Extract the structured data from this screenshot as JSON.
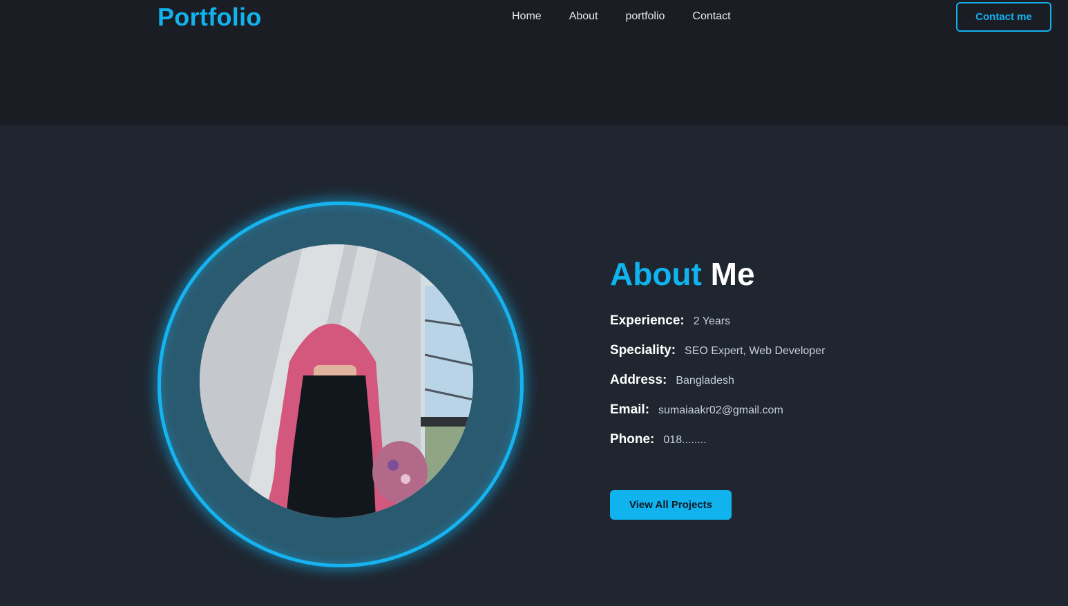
{
  "header": {
    "logo": "Portfolio",
    "nav": [
      "Home",
      "About",
      "portfolio",
      "Contact"
    ],
    "contact_button": "Contact me"
  },
  "about": {
    "title_accent": "About",
    "title_rest": "Me",
    "rows": [
      {
        "label": "Experience:",
        "value": "2 Years"
      },
      {
        "label": "Speciality:",
        "value": "SEO Expert, Web Developer"
      },
      {
        "label": "Address:",
        "value": "Bangladesh"
      },
      {
        "label": "Email:",
        "value": "sumaiaakr02@gmail.com"
      },
      {
        "label": "Phone:",
        "value": "018........"
      }
    ],
    "projects_button": "View All Projects"
  },
  "colors": {
    "accent": "#11b3ef",
    "header_bg": "#1a1d23",
    "page_bg": "#1f2630",
    "ring_fill": "#2a5a70"
  }
}
